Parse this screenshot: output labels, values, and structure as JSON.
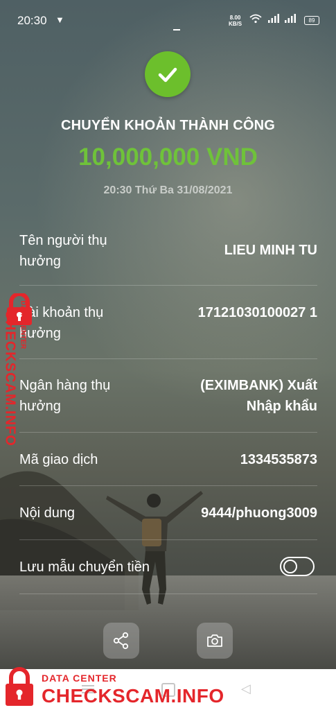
{
  "status_bar": {
    "time": "20:30",
    "net_speed_value": "8.00",
    "net_speed_unit": "KB/S",
    "battery": "89",
    "icons": [
      "shield-icon",
      "wifi-icon",
      "signal-icon",
      "signal-icon",
      "battery-icon"
    ]
  },
  "header": {
    "icon": "check-icon",
    "title": "CHUYỂN KHOẢN THÀNH CÔNG",
    "amount": "10,000,000 VND",
    "datetime": "20:30 Thứ Ba 31/08/2021"
  },
  "details": [
    {
      "label": "Tên người thụ hưởng",
      "value": "LIEU MINH TU"
    },
    {
      "label": "Tài khoản thụ hưởng",
      "value": "17121030100027 1"
    },
    {
      "label": "Ngân hàng thụ hưởng",
      "value": "(EXIMBANK) Xuất Nhập khẩu"
    },
    {
      "label": "Mã giao dịch",
      "value": "1334535873"
    },
    {
      "label": "Nội dung",
      "value": "9444/phuong3009"
    }
  ],
  "save_template": {
    "label": "Lưu mẫu chuyển tiền",
    "enabled": false
  },
  "actions": [
    {
      "icon": "share-icon"
    },
    {
      "icon": "camera-icon"
    }
  ],
  "watermark": {
    "small": "DATA CENTER",
    "big": "CHECKSCAM.INFO"
  },
  "colors": {
    "success_green": "#6cbf2c",
    "amount_green": "#6fc23a",
    "watermark_red": "#e4262b"
  }
}
